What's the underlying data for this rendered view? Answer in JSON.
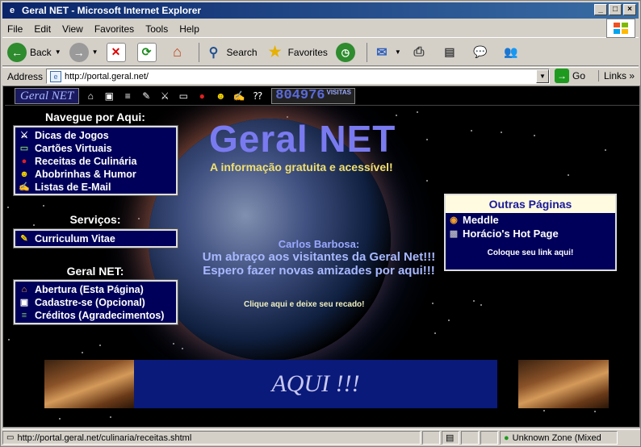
{
  "window": {
    "title": "Geral NET - Microsoft Internet Explorer"
  },
  "menu": [
    "File",
    "Edit",
    "View",
    "Favorites",
    "Tools",
    "Help"
  ],
  "toolbar": {
    "back": "Back",
    "search": "Search",
    "favorites": "Favorites"
  },
  "address": {
    "label": "Address",
    "url": "http://portal.geral.net/",
    "go": "Go",
    "links": "Links"
  },
  "site": {
    "logo": "Geral NET",
    "counter": "804976",
    "counter_suffix": "VISITAS",
    "title": "Geral NET",
    "subtitle": "A informação gratuita e acessível!",
    "nav_heading": "Navegue por Aqui:",
    "nav_items": [
      "Dicas de Jogos",
      "Cartões Virtuais",
      "Receitas de Culinária",
      "Abobrinhas & Humor",
      "Listas de E-Mail"
    ],
    "services_heading": "Serviços:",
    "services_items": [
      "Curriculum Vitae"
    ],
    "geral_heading": "Geral NET:",
    "geral_items": [
      "Abertura (Esta Página)",
      "Cadastre-se (Opcional)",
      "Créditos (Agradecimentos)"
    ],
    "message": {
      "author": "Carlos Barbosa:",
      "line1": "Um abraço aos visitantes da Geral Net!!!",
      "line2": "Espero fazer novas amizades por aqui!!!"
    },
    "recado": "Clique aqui e deixe seu recado!",
    "outras": {
      "heading": "Outras Páginas",
      "items": [
        "Meddle",
        "Horácio's Hot Page"
      ],
      "footer": "Coloque seu link aqui!"
    },
    "banner": "AQUI !!!"
  },
  "status": {
    "url": "http://portal.geral.net/culinaria/receitas.shtml",
    "zone": "Unknown Zone (Mixed"
  }
}
